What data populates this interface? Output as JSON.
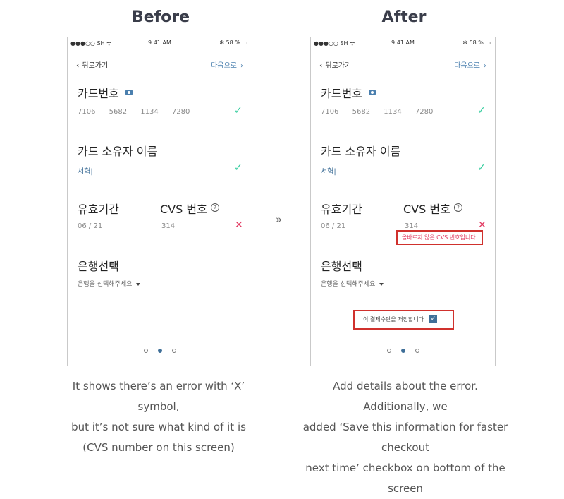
{
  "before": {
    "heading": "Before",
    "status": {
      "carrier": "●●●○○ SH ᯤ",
      "time": "9:41 AM",
      "battery": "✻ 58 % ▭"
    },
    "nav": {
      "back": "뒤로가기",
      "next": "다음으로"
    },
    "card_number": {
      "label": "카드번호",
      "groups": [
        "7106",
        "5682",
        "1134",
        "7280"
      ]
    },
    "card_holder": {
      "label": "카드 소유자 이름",
      "value": "서혁|"
    },
    "expiry": {
      "label": "유효기간",
      "value": "06  /  21"
    },
    "cvs": {
      "label": "CVS 번호",
      "value": "314"
    },
    "bank": {
      "label": "은행선택",
      "placeholder": "은행을 선택해주세요"
    },
    "caption_lines": [
      "It shows there’s an error with ‘X’ symbol,",
      "but it’s not sure what kind of it is",
      "(CVS number on this screen)"
    ]
  },
  "after": {
    "heading": "After",
    "status": {
      "carrier": "●●●○○ SH ᯤ",
      "time": "9:41 AM",
      "battery": "✻ 58 % ▭"
    },
    "nav": {
      "back": "뒤로가기",
      "next": "다음으로"
    },
    "card_number": {
      "label": "카드번호",
      "groups": [
        "7106",
        "5682",
        "1134",
        "7280"
      ]
    },
    "card_holder": {
      "label": "카드 소유자 이름",
      "value": "서혁|"
    },
    "expiry": {
      "label": "유효기간",
      "value": "06  /  21"
    },
    "cvs": {
      "label": "CVS 번호",
      "value": "314",
      "error": "올바르지 않은 CVS 번호입니다."
    },
    "bank": {
      "label": "은행선택",
      "placeholder": "은행을 선택해주세요"
    },
    "save_checkbox": {
      "label": "이 결제수단을 저장합니다",
      "checked": true
    },
    "caption_lines": [
      "Add details about the error. Additionally, we",
      "added ‘Save this information for faster checkout",
      "next time’ checkbox on bottom of the screen"
    ]
  },
  "middle_arrow": "»",
  "icons": {
    "check": "check-icon",
    "error": "x-icon",
    "camera": "camera-icon",
    "help": "help-circle-icon",
    "dropdown": "caret-down-icon",
    "back": "chevron-left-icon",
    "next": "chevron-right-icon"
  },
  "colors": {
    "check": "#2ecb9b",
    "error": "#e23a62",
    "link": "#4a7fae",
    "highlight_box": "#d0312d"
  }
}
